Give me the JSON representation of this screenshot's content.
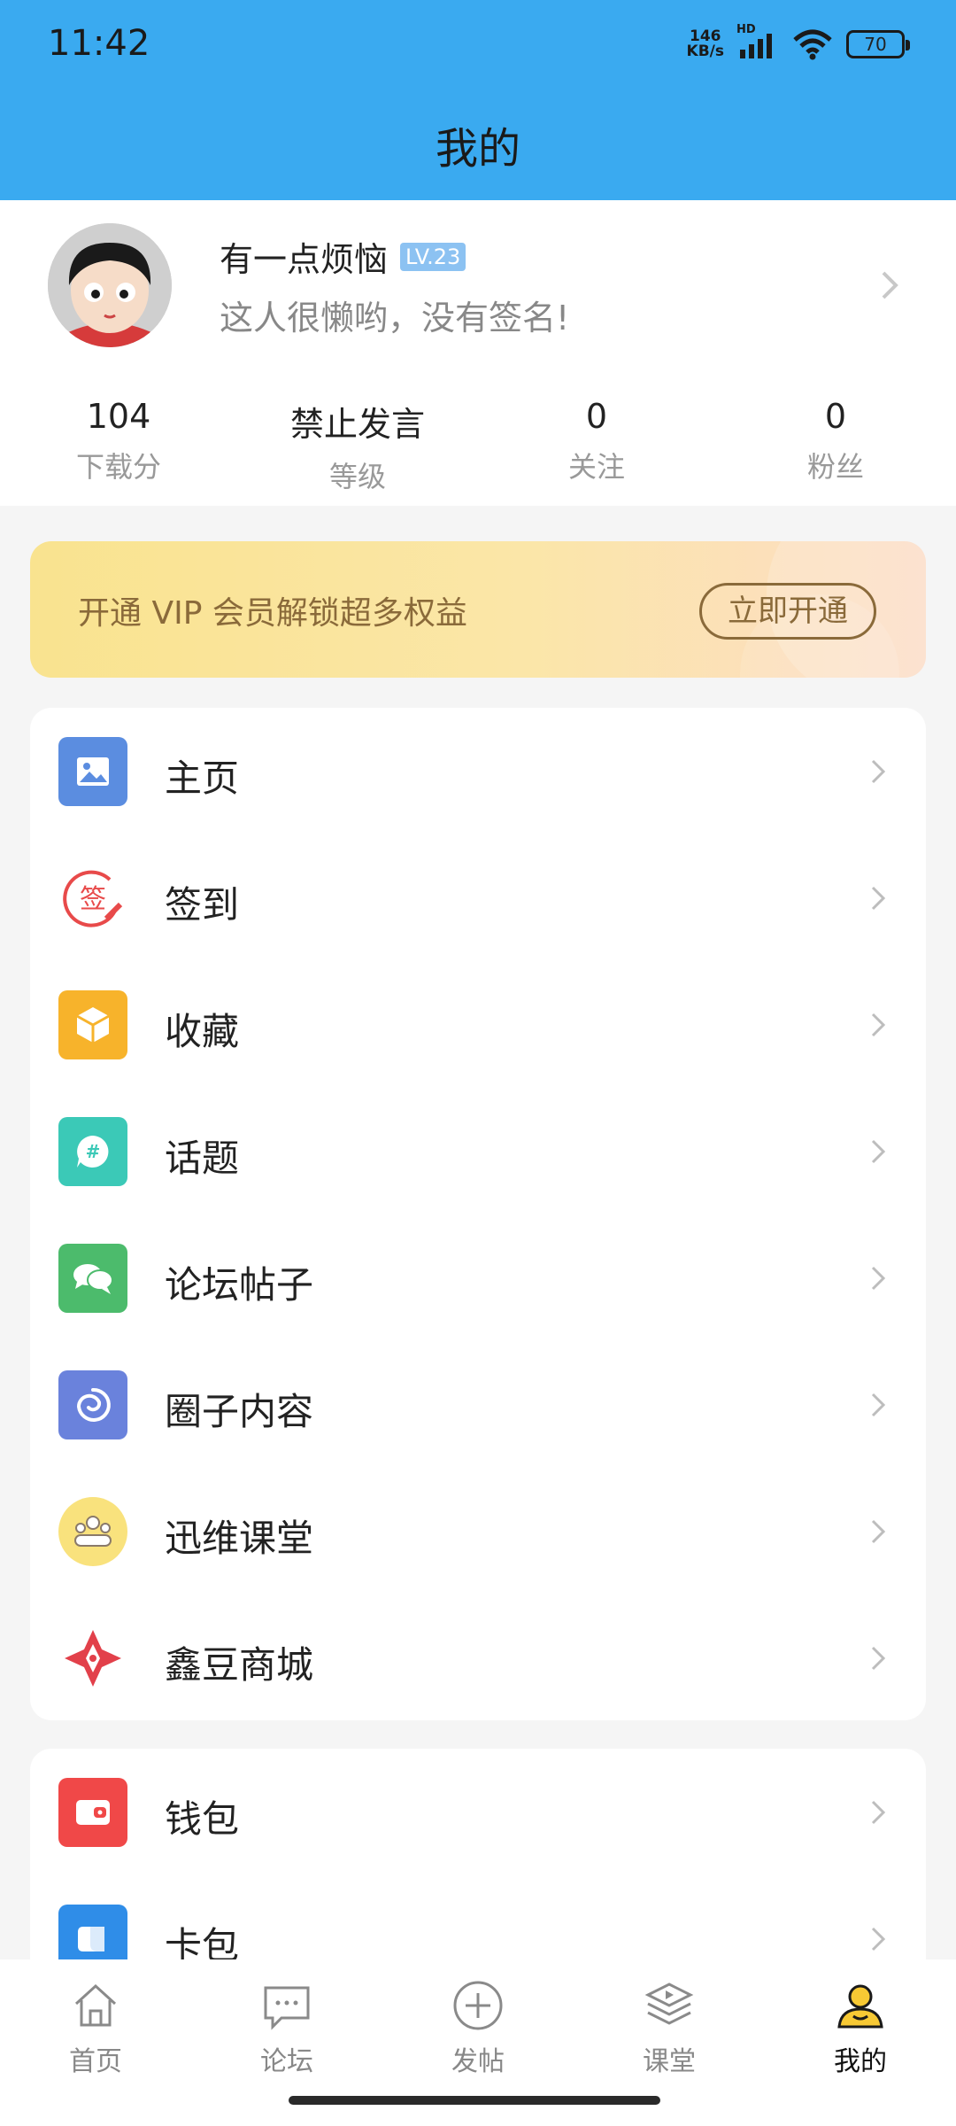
{
  "status_bar": {
    "time": "11:42",
    "net_speed_value": "146",
    "net_speed_unit": "KB/s",
    "hd": "HD",
    "battery": "70"
  },
  "header": {
    "title": "我的"
  },
  "profile": {
    "name": "有一点烦恼",
    "level": "LV.23",
    "signature": "这人很懒哟，没有签名!",
    "stats": [
      {
        "value": "104",
        "label": "下载分"
      },
      {
        "value": "禁止发言",
        "label": "等级"
      },
      {
        "value": "0",
        "label": "关注"
      },
      {
        "value": "0",
        "label": "粉丝"
      }
    ]
  },
  "vip": {
    "text": "开通 VIP 会员解锁超多权益",
    "button": "立即开通"
  },
  "menu_group_1": [
    {
      "label": "主页",
      "icon": "image-icon",
      "color": "#5b8de0"
    },
    {
      "label": "签到",
      "icon": "sign-in-icon",
      "color": "#e84a4a"
    },
    {
      "label": "收藏",
      "icon": "box-icon",
      "color": "#f7b32b"
    },
    {
      "label": "话题",
      "icon": "hashtag-chat-icon",
      "color": "#3bc9b7"
    },
    {
      "label": "论坛帖子",
      "icon": "chat-bubbles-icon",
      "color": "#4cbb6c"
    },
    {
      "label": "圈子内容",
      "icon": "spiral-icon",
      "color": "#6a82dc"
    },
    {
      "label": "迅维课堂",
      "icon": "classroom-icon",
      "color": "#f9e27d"
    },
    {
      "label": "鑫豆商城",
      "icon": "mall-diamond-icon",
      "color": "#e2404a"
    }
  ],
  "menu_group_2": [
    {
      "label": "钱包",
      "icon": "wallet-icon",
      "color": "#f04848"
    },
    {
      "label": "卡包",
      "icon": "card-pack-icon",
      "color": "#2f8de8"
    }
  ],
  "tabbar": [
    {
      "label": "首页",
      "icon": "home-icon"
    },
    {
      "label": "论坛",
      "icon": "forum-icon"
    },
    {
      "label": "发帖",
      "icon": "plus-circle-icon"
    },
    {
      "label": "课堂",
      "icon": "classroom-play-icon"
    },
    {
      "label": "我的",
      "icon": "user-icon",
      "active": true
    }
  ]
}
